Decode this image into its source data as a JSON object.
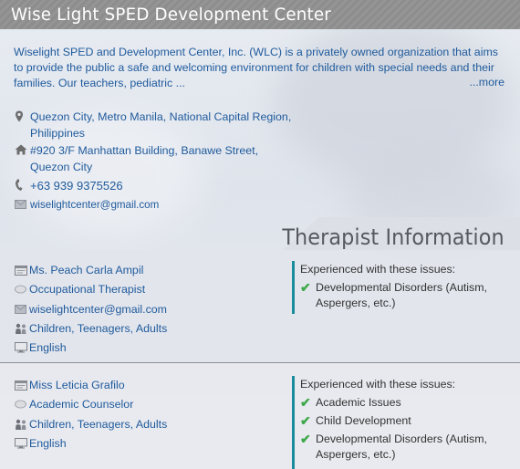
{
  "center": {
    "name": "Wise Light SPED Development Center",
    "description": "Wiselight SPED and Development Center, Inc. (WLC) is a privately owned organization that aims to provide the public a safe and welcoming environment for children with special needs and their families. Our teachers, pediatric ...",
    "more_label": "...more",
    "location_line1": "Quezon City, Metro Manila, National Capital Region,",
    "location_line2": "Philippines",
    "address_line1": "#920 3/F Manhattan Building, Banawe Street,",
    "address_line2": "Quezon City",
    "phone": "+63 939 9375526",
    "email": "wiselightcenter@gmail.com"
  },
  "section": {
    "title": "Therapist Information"
  },
  "therapists": [
    {
      "name": "Ms. Peach Carla Ampil",
      "role": "Occupational Therapist",
      "email": "wiselightcenter@gmail.com",
      "ages": "Children, Teenagers, Adults",
      "language": "English",
      "issues_heading": "Experienced with these issues:",
      "issues": [
        "Developmental Disorders (Autism, Aspergers, etc.)"
      ]
    },
    {
      "name": "Miss Leticia Grafilo",
      "role": "Academic Counselor",
      "ages": "Children, Teenagers, Adults",
      "language": "English",
      "issues_heading": "Experienced with these issues:",
      "issues": [
        "Academic Issues",
        "Child Development",
        "Developmental Disorders (Autism, Aspergers, etc.)"
      ]
    }
  ],
  "colors": {
    "link": "#1f5a9c",
    "header_bg": "#8d8d8d",
    "accent_border": "#1a8c9c",
    "check": "#3fa84a"
  }
}
